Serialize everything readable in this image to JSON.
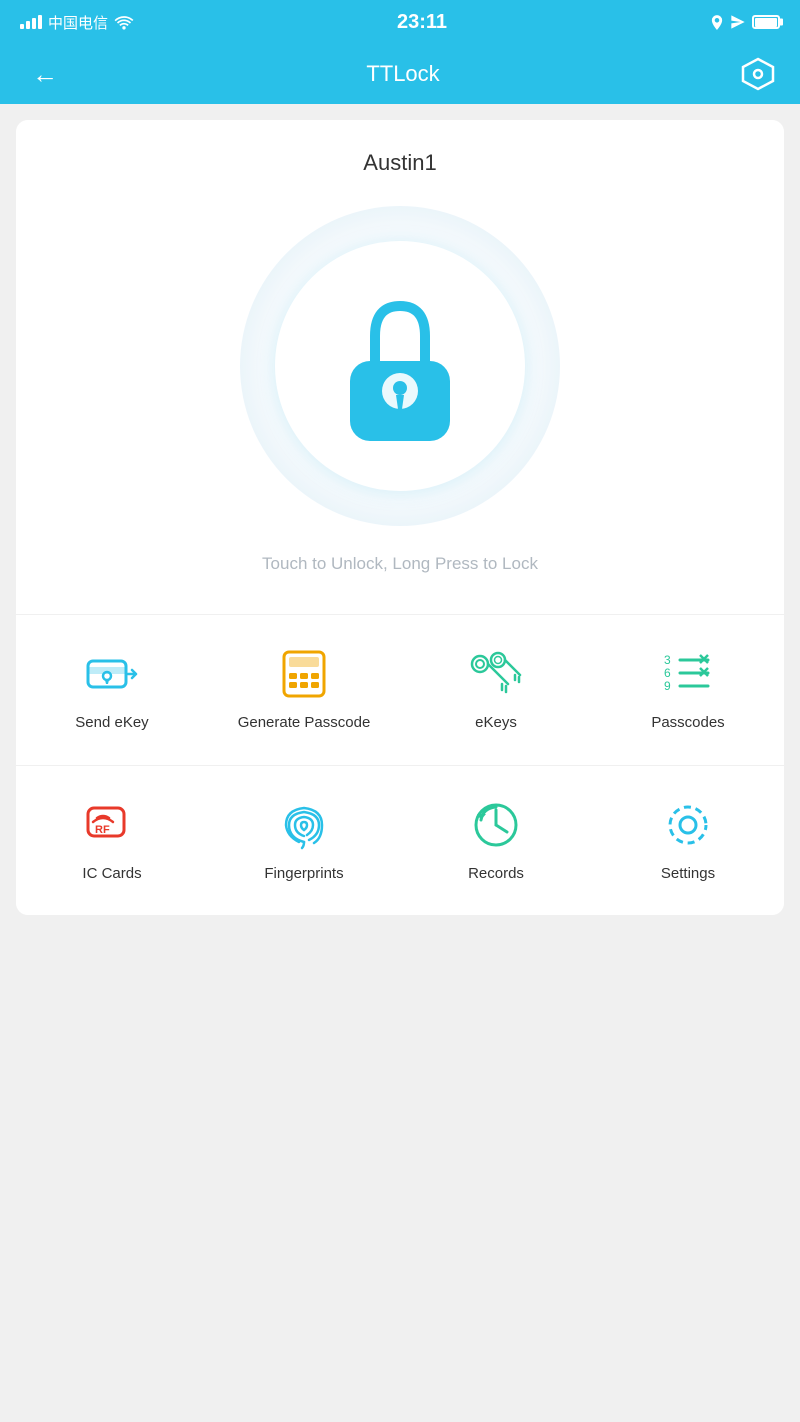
{
  "statusBar": {
    "carrier": "中国电信",
    "time": "23:11",
    "icons": [
      "location",
      "battery"
    ]
  },
  "header": {
    "title": "TTLock",
    "back_label": "←",
    "settings_label": "⬡"
  },
  "lock": {
    "name": "Austin1",
    "hint": "Touch to Unlock, Long Press to Lock"
  },
  "menuRow1": [
    {
      "id": "send-ekey",
      "label": "Send eKey",
      "color": "#29C0E8"
    },
    {
      "id": "generate-passcode",
      "label": "Generate\nPasscode",
      "color": "#F0A500"
    },
    {
      "id": "ekeys",
      "label": "eKeys",
      "color": "#2BC89A"
    },
    {
      "id": "passcodes",
      "label": "Passcodes",
      "color": "#2BC89A"
    }
  ],
  "menuRow2": [
    {
      "id": "ic-cards",
      "label": "IC Cards",
      "color": "#E8392A"
    },
    {
      "id": "fingerprints",
      "label": "Fingerprints",
      "color": "#29C0E8"
    },
    {
      "id": "records",
      "label": "Records",
      "color": "#2BC89A"
    },
    {
      "id": "settings",
      "label": "Settings",
      "color": "#29C0E8"
    }
  ]
}
